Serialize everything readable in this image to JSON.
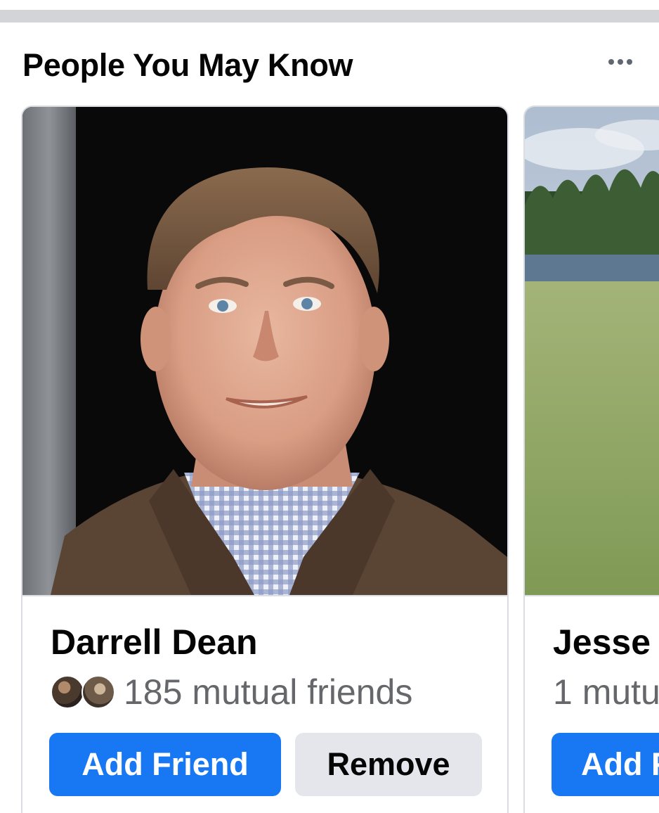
{
  "section": {
    "title": "People You May Know",
    "more_icon": "more-horizontal-icon"
  },
  "suggestions": [
    {
      "name": "Darrell Dean",
      "mutual_friends_text": "185 mutual friends",
      "add_label": "Add Friend",
      "remove_label": "Remove"
    },
    {
      "name": "Jesse",
      "mutual_friends_text": "1 mutu",
      "add_label": "Add F"
    }
  ],
  "colors": {
    "primary_button": "#1877f2",
    "secondary_button": "#e4e6eb",
    "secondary_text": "#65676b",
    "divider": "#d3d4d8"
  }
}
